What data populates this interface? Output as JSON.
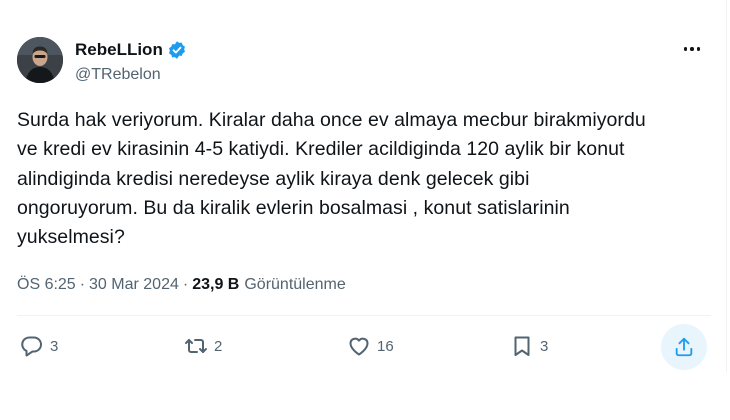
{
  "author": {
    "display_name": "RebeLLion",
    "handle": "@TRebelon",
    "verified": true,
    "avatar_icon": "profile-photo"
  },
  "tweet": {
    "text": "Surda hak veriyorum. Kiralar daha once ev almaya mecbur birakmiyordu\nve kredi ev kirasinin 4-5 katiydi. Krediler acildiginda 120 aylik bir konut\nalindiginda kredisi neredeyse aylik kiraya denk gelecek gibi\nongoruyorum. Bu da kiralik evlerin bosalmasi , konut satislarinin\nyukselmesi?"
  },
  "meta": {
    "time": "ÖS 6:25",
    "separator1": "·",
    "date": "30 Mar 2024",
    "separator2": "·",
    "views": "23,9 B",
    "views_label": "Görüntülenme"
  },
  "actions": {
    "reply": {
      "count": "3",
      "icon": "reply-icon"
    },
    "retweet": {
      "count": "2",
      "icon": "retweet-icon"
    },
    "like": {
      "count": "16",
      "icon": "heart-icon"
    },
    "bookmark": {
      "count": "3",
      "icon": "bookmark-icon"
    },
    "share": {
      "icon": "share-icon"
    }
  },
  "colors": {
    "text": "#0f1419",
    "secondary": "#536471",
    "accent": "#1d9bf0",
    "share_bg": "#e8f5fd"
  }
}
